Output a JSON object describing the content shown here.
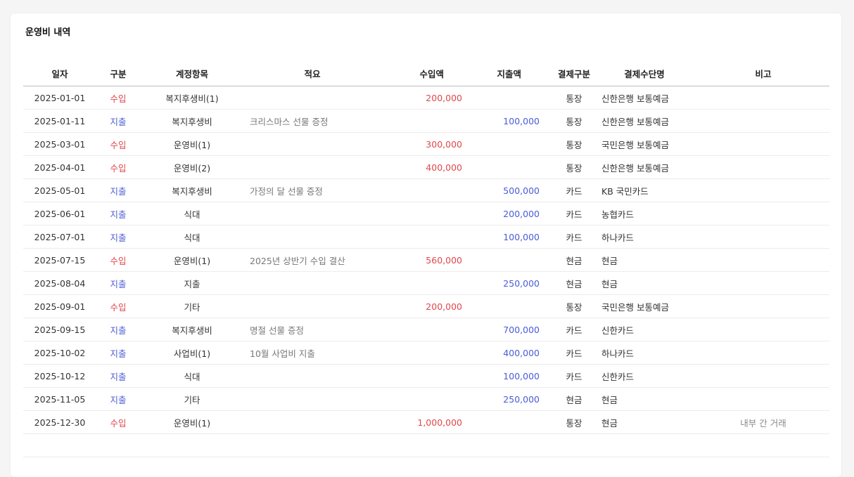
{
  "panel": {
    "title": "운영비 내역"
  },
  "table": {
    "headers": {
      "date": "일자",
      "type": "구분",
      "account": "계정항목",
      "description": "적요",
      "income": "수입액",
      "expense": "지출액",
      "payment_type": "결제구분",
      "payment_name": "결제수단명",
      "note": "비고"
    },
    "rows": [
      {
        "date": "2025-01-01",
        "type": "수입",
        "kind": "in",
        "account": "복지후생비(1)",
        "description": "",
        "income": "200,000",
        "expense": "",
        "payment_type": "통장",
        "payment_name": "신한은행 보통예금",
        "note": ""
      },
      {
        "date": "2025-01-11",
        "type": "지출",
        "kind": "out",
        "account": "복지후생비",
        "description": "크리스마스 선물 증정",
        "income": "",
        "expense": "100,000",
        "payment_type": "통장",
        "payment_name": "신한은행 보통예금",
        "note": ""
      },
      {
        "date": "2025-03-01",
        "type": "수입",
        "kind": "in",
        "account": "운영비(1)",
        "description": "",
        "income": "300,000",
        "expense": "",
        "payment_type": "통장",
        "payment_name": "국민은행 보통예금",
        "note": ""
      },
      {
        "date": "2025-04-01",
        "type": "수입",
        "kind": "in",
        "account": "운영비(2)",
        "description": "",
        "income": "400,000",
        "expense": "",
        "payment_type": "통장",
        "payment_name": "신한은행 보통예금",
        "note": ""
      },
      {
        "date": "2025-05-01",
        "type": "지출",
        "kind": "out",
        "account": "복지후생비",
        "description": "가정의 달 선물 증정",
        "income": "",
        "expense": "500,000",
        "payment_type": "카드",
        "payment_name": "KB 국민카드",
        "note": ""
      },
      {
        "date": "2025-06-01",
        "type": "지출",
        "kind": "out",
        "account": "식대",
        "description": "",
        "income": "",
        "expense": "200,000",
        "payment_type": "카드",
        "payment_name": "농협카드",
        "note": ""
      },
      {
        "date": "2025-07-01",
        "type": "지출",
        "kind": "out",
        "account": "식대",
        "description": "",
        "income": "",
        "expense": "100,000",
        "payment_type": "카드",
        "payment_name": "하나카드",
        "note": ""
      },
      {
        "date": "2025-07-15",
        "type": "수입",
        "kind": "in",
        "account": "운영비(1)",
        "description": "2025년 상반기 수입 결산",
        "income": "560,000",
        "expense": "",
        "payment_type": "현금",
        "payment_name": "현금",
        "note": ""
      },
      {
        "date": "2025-08-04",
        "type": "지출",
        "kind": "out",
        "account": "지출",
        "description": "",
        "income": "",
        "expense": "250,000",
        "payment_type": "현금",
        "payment_name": "현금",
        "note": ""
      },
      {
        "date": "2025-09-01",
        "type": "수입",
        "kind": "in",
        "account": "기타",
        "description": "",
        "income": "200,000",
        "expense": "",
        "payment_type": "통장",
        "payment_name": "국민은행 보통예금",
        "note": ""
      },
      {
        "date": "2025-09-15",
        "type": "지출",
        "kind": "out",
        "account": "복지후생비",
        "description": "명절 선물 증정",
        "income": "",
        "expense": "700,000",
        "payment_type": "카드",
        "payment_name": "신한카드",
        "note": ""
      },
      {
        "date": "2025-10-02",
        "type": "지출",
        "kind": "out",
        "account": "사업비(1)",
        "description": "10월 사업비 지출",
        "income": "",
        "expense": "400,000",
        "payment_type": "카드",
        "payment_name": "하나카드",
        "note": ""
      },
      {
        "date": "2025-10-12",
        "type": "지출",
        "kind": "out",
        "account": "식대",
        "description": "",
        "income": "",
        "expense": "100,000",
        "payment_type": "카드",
        "payment_name": "신한카드",
        "note": ""
      },
      {
        "date": "2025-11-05",
        "type": "지출",
        "kind": "out",
        "account": "기타",
        "description": "",
        "income": "",
        "expense": "250,000",
        "payment_type": "현금",
        "payment_name": "현금",
        "note": ""
      },
      {
        "date": "2025-12-30",
        "type": "수입",
        "kind": "in",
        "account": "운영비(1)",
        "description": "",
        "income": "1,000,000",
        "expense": "",
        "payment_type": "통장",
        "payment_name": "현금",
        "note": "내부 간 거래"
      }
    ]
  },
  "colors": {
    "income": "#e0474c",
    "expense": "#4a5bd6"
  }
}
